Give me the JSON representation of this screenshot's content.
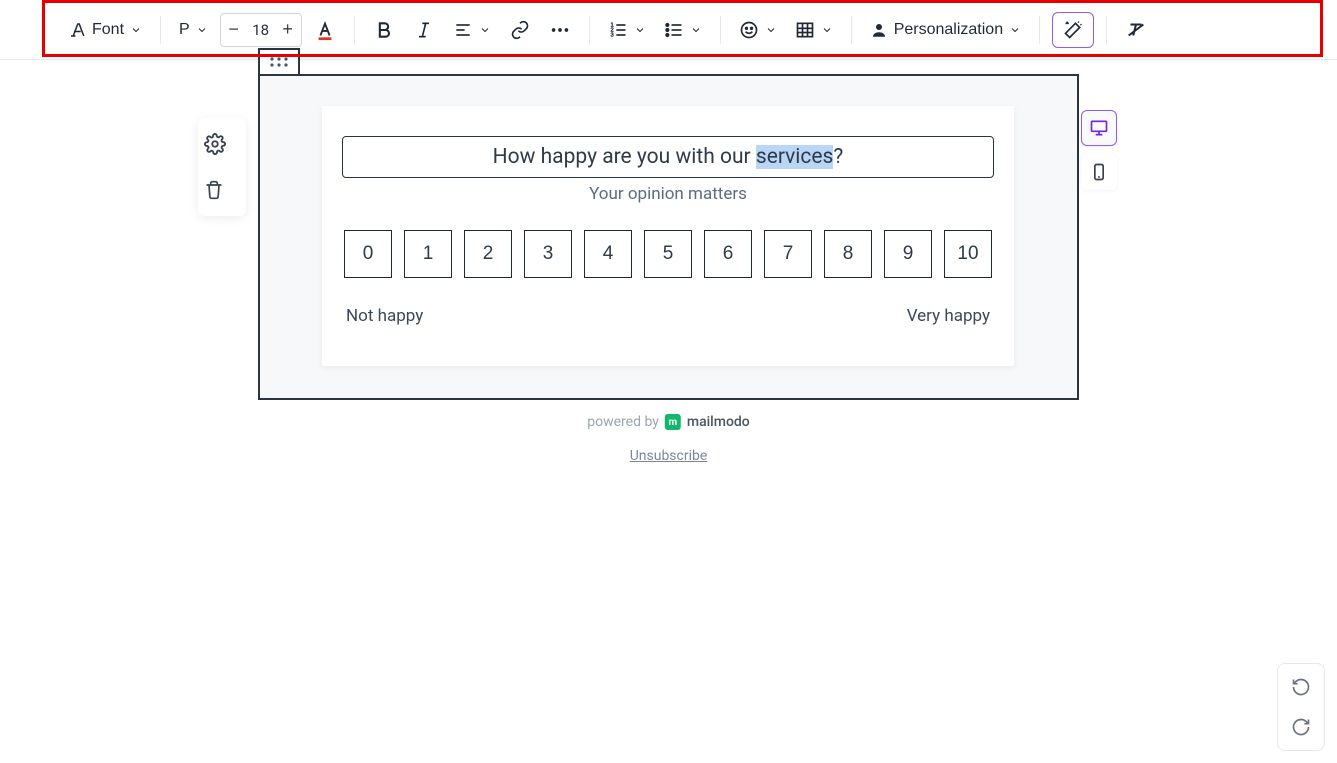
{
  "toolbar": {
    "font_label": "Font",
    "paragraph_label": "P",
    "font_size": "18",
    "personalization_label": "Personalization"
  },
  "survey": {
    "question_pre": "How happy are you with our ",
    "question_sel": "services",
    "question_post": "?",
    "subtitle": "Your opinion matters",
    "scale": [
      "0",
      "1",
      "2",
      "3",
      "4",
      "5",
      "6",
      "7",
      "8",
      "9",
      "10"
    ],
    "label_low": "Not happy",
    "label_high": "Very happy"
  },
  "footer": {
    "powered_by": "powered by",
    "brand": "mailmodo",
    "unsubscribe": "Unsubscribe"
  }
}
